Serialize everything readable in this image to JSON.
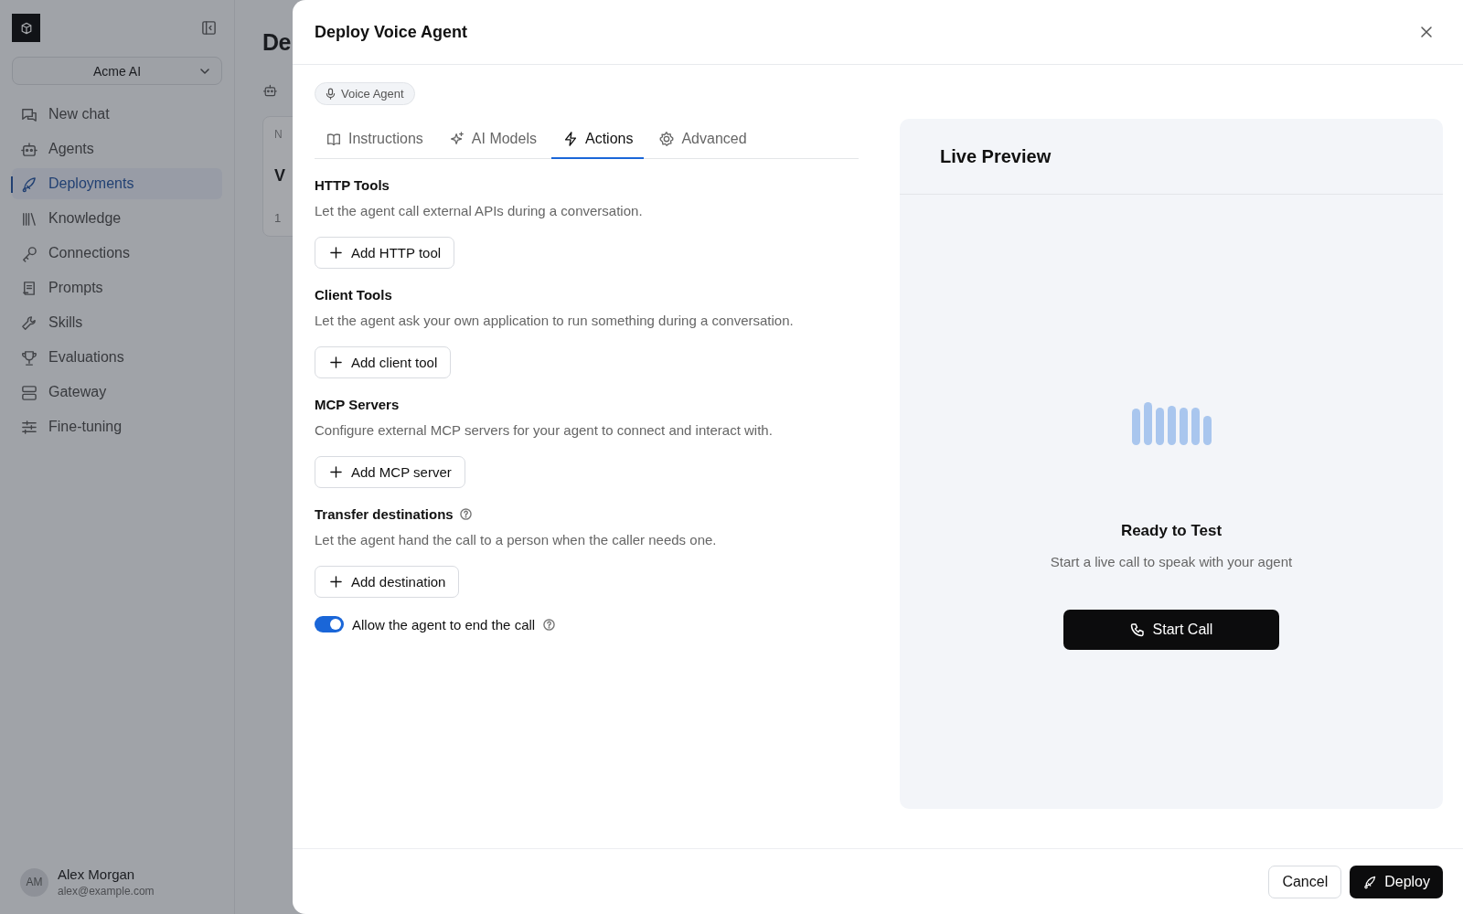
{
  "sidebar": {
    "workspace": "Acme AI",
    "items": [
      {
        "label": "New chat",
        "selected": false
      },
      {
        "label": "Agents",
        "selected": false
      },
      {
        "label": "Deployments",
        "selected": true
      },
      {
        "label": "Knowledge",
        "selected": false
      },
      {
        "label": "Connections",
        "selected": false
      },
      {
        "label": "Prompts",
        "selected": false
      },
      {
        "label": "Skills",
        "selected": false
      },
      {
        "label": "Evaluations",
        "selected": false
      },
      {
        "label": "Gateway",
        "selected": false
      },
      {
        "label": "Fine-tuning",
        "selected": false
      }
    ],
    "user": {
      "initials": "AM",
      "name": "Alex Morgan",
      "email": "alex@example.com"
    }
  },
  "background_page": {
    "title": "De",
    "table_header": "N",
    "row": "V",
    "footer": "1"
  },
  "dialog": {
    "title": "Deploy Voice Agent",
    "badge": "Voice Agent",
    "tabs": [
      {
        "label": "Instructions",
        "selected": false
      },
      {
        "label": "AI Models",
        "selected": false
      },
      {
        "label": "Actions",
        "selected": true
      },
      {
        "label": "Advanced",
        "selected": false
      }
    ],
    "sections": [
      {
        "title": "HTTP Tools",
        "help": false,
        "description": "Let the agent call external APIs during a conversation.",
        "button": "Add HTTP tool"
      },
      {
        "title": "Client Tools",
        "help": false,
        "description": "Let the agent ask your own application to run something during a conversation.",
        "button": "Add client tool"
      },
      {
        "title": "MCP Servers",
        "help": false,
        "description": "Configure external MCP servers for your agent to connect and interact with.",
        "button": "Add MCP server"
      },
      {
        "title": "Transfer destinations",
        "help": true,
        "description": "Let the agent hand the call to a person when the caller needs one.",
        "button": "Add destination"
      }
    ],
    "end_call_toggle": {
      "label": "Allow the agent to end the call",
      "on": true
    },
    "preview": {
      "title": "Live Preview",
      "heading": "Ready to Test",
      "subtitle": "Start a live call to speak with your agent",
      "button": "Start Call"
    },
    "buttons": {
      "cancel": "Cancel",
      "deploy": "Deploy"
    }
  }
}
